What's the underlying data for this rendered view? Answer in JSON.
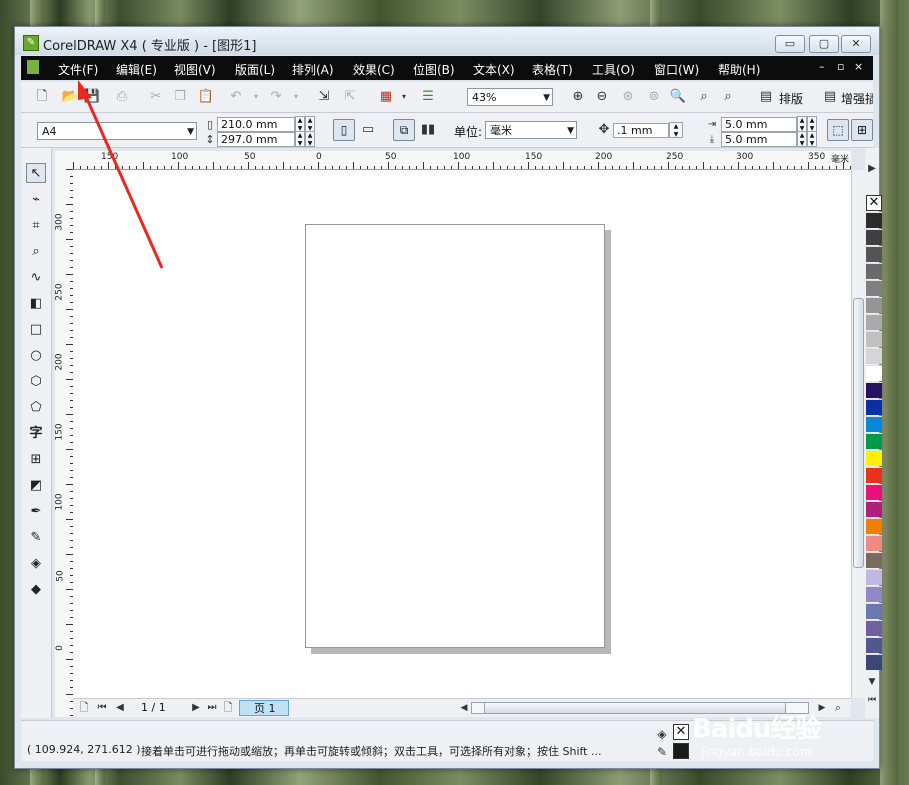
{
  "window": {
    "title": "CorelDRAW X4 ( 专业版 ) - [图形1]",
    "controls": [
      "▭",
      "▢",
      "✕"
    ]
  },
  "menu": [
    "文件(F)",
    "编辑(E)",
    "视图(V)",
    "版面(L)",
    "排列(A)",
    "效果(C)",
    "位图(B)",
    "文本(X)",
    "表格(T)",
    "工具(O)",
    "窗口(W)",
    "帮助(H)"
  ],
  "menu_window_controls": [
    "–",
    "▫",
    "×"
  ],
  "standard_toolbar": {
    "zoom": "43%",
    "arrange_label": "排版",
    "enhance_label": "增强插"
  },
  "property_bar": {
    "paper_size": "A4",
    "width": "210.0 mm",
    "height": "297.0 mm",
    "units_label": "单位:",
    "units_value": "毫米",
    "nudge": ".1 mm",
    "dup_x": "5.0 mm",
    "dup_y": "5.0 mm"
  },
  "ruler": {
    "h_labels": [
      "150",
      "100",
      "50",
      "0",
      "50",
      "100",
      "150",
      "200",
      "250",
      "300",
      "350"
    ],
    "h_unit": "毫米",
    "v_labels": [
      "300",
      "250",
      "200",
      "150",
      "100",
      "50",
      "0"
    ]
  },
  "page_nav": {
    "counter": "1 / 1",
    "tab": "页 1"
  },
  "status": {
    "coords": "( 109.924, 271.612 )",
    "message": "接着单击可进行拖动或缩放；再单击可旋转或倾斜；双击工具，可选择所有对象；按住 Shift ..."
  },
  "palette_colors": [
    "#2b2b2b",
    "#404040",
    "#555555",
    "#6a6a6a",
    "#808080",
    "#959595",
    "#aaaaaa",
    "#c0c0c0",
    "#d5d5d5",
    "#ffffff",
    "#2a1060",
    "#0b2fa5",
    "#0a88d8",
    "#009a48",
    "#fff000",
    "#e8321c",
    "#e8107a",
    "#b0207a",
    "#f08000",
    "#f08a80",
    "#7a6a60",
    "#c0b8e0",
    "#9088c8",
    "#6a78b0",
    "#7060a0",
    "#505890",
    "#3a4878"
  ],
  "watermark": {
    "brand": "Baidu经验",
    "url": "jingyan.baidu.com"
  }
}
